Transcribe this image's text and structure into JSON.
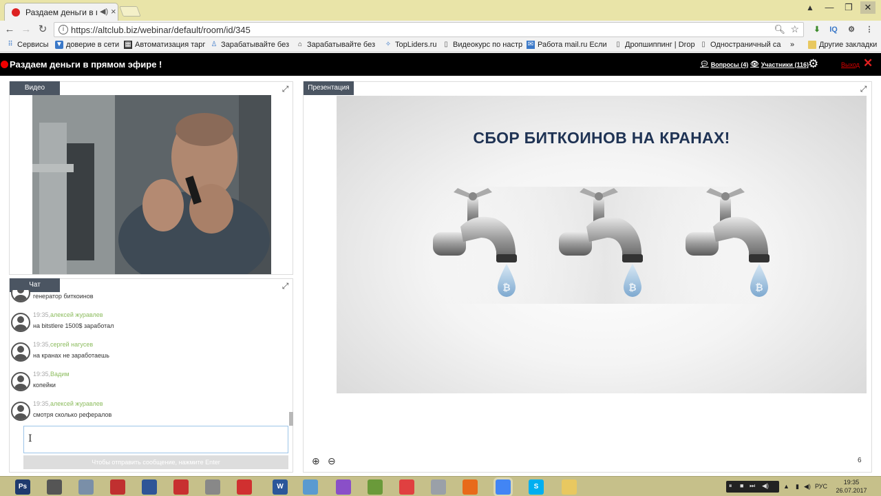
{
  "browser": {
    "tab_title": "Раздаем деньги в пр",
    "url": "https://altclub.biz/webinar/default/room/id/345",
    "extension_iq": "IQ",
    "bookmarks": [
      {
        "label": "Сервисы",
        "icon": "apps-grid-icon"
      },
      {
        "label": "доверие в сети",
        "icon": "shield-icon"
      },
      {
        "label": "Автоматизация тарг",
        "icon": "film-icon"
      },
      {
        "label": "Зарабатывайте без",
        "icon": "person-icon"
      },
      {
        "label": "Зарабатывайте без",
        "icon": "home-icon"
      },
      {
        "label": "TopLiders.ru",
        "icon": "star-icon"
      },
      {
        "label": "Видеокурс по настр",
        "icon": "page-icon"
      },
      {
        "label": "Работа mail.ru Если",
        "icon": "mail-icon"
      },
      {
        "label": "Дропшиппинг | Drop",
        "icon": "page-icon"
      },
      {
        "label": "Одностраничный са",
        "icon": "page-icon"
      }
    ],
    "more_bookmarks": "»",
    "other_bookmarks": "Другие закладки"
  },
  "app": {
    "title": "Раздаем деньги в прямом эфире !",
    "questions_link": "Вопросы (4)",
    "participants_link": "Участники (116)",
    "exit_label": "Выход"
  },
  "video_panel": {
    "tab_label": "Видео"
  },
  "chat_panel": {
    "tab_label": "Чат",
    "messages": [
      {
        "time": "",
        "author": "",
        "text": "генератор биткоинов"
      },
      {
        "time": "19:35,",
        "author": "алексей журавлев",
        "text": "на bitstlere 1500$ заработал"
      },
      {
        "time": "19:35,",
        "author": "сергей нагусев",
        "text": "на кранах не заработаешь"
      },
      {
        "time": "19:35,",
        "author": "Вадим",
        "text": "копейки"
      },
      {
        "time": "19:35,",
        "author": "алексей журавлев",
        "text": "смотря сколько рефералов"
      }
    ],
    "input_value": "",
    "send_hint": "Чтобы отправить сообщение, нажмите Enter"
  },
  "presentation_panel": {
    "tab_label": "Презентация",
    "slide_title": "СБОР БИТКОИНОВ НА КРАНАХ!",
    "slide_number": "6"
  },
  "taskbar": {
    "apps": [
      {
        "name": "Ps",
        "color": "#1e3a6e"
      },
      {
        "name": "",
        "color": "#555555"
      },
      {
        "name": "",
        "color": "#7a8fa8"
      },
      {
        "name": "",
        "color": "#c03030"
      },
      {
        "name": "",
        "color": "#2f5597"
      },
      {
        "name": "",
        "color": "#c83030"
      },
      {
        "name": "",
        "color": "#888888"
      },
      {
        "name": "",
        "color": "#d03030"
      },
      {
        "name": "W",
        "color": "#2b579a"
      },
      {
        "name": "",
        "color": "#5a9ad0"
      },
      {
        "name": "",
        "color": "#8a4fc8"
      },
      {
        "name": "",
        "color": "#6a9a3a"
      },
      {
        "name": "",
        "color": "#e04040"
      },
      {
        "name": "",
        "color": "#9aa0a8"
      },
      {
        "name": "",
        "color": "#e86a1a"
      },
      {
        "name": "",
        "color": "#4285f4"
      },
      {
        "name": "S",
        "color": "#00aff0"
      },
      {
        "name": "",
        "color": "#e8c860"
      }
    ],
    "language": "РУС",
    "time": "19:35",
    "date": "26.07.2017"
  }
}
